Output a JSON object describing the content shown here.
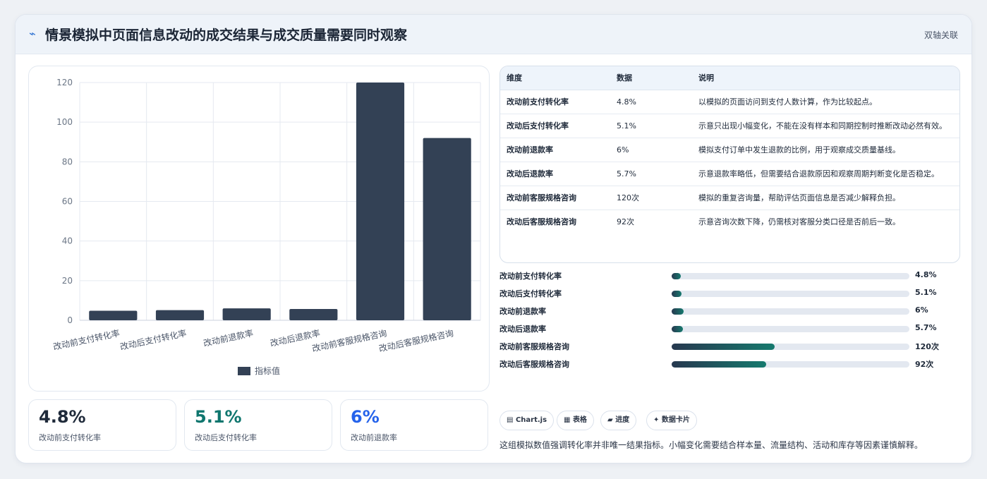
{
  "header": {
    "icon": "pulse-icon",
    "title": "情景模拟中页面信息改动的成交结果与成交质量需要同时观察",
    "mode": "双轴关联"
  },
  "chart_data": {
    "type": "bar",
    "categories": [
      "改动前支付转化率",
      "改动后支付转化率",
      "改动前退款率",
      "改动后退款率",
      "改动前客服规格咨询",
      "改动后客服规格咨询"
    ],
    "series": [
      {
        "name": "指标值",
        "values": [
          4.8,
          5.1,
          6,
          5.7,
          120,
          92
        ]
      }
    ],
    "ylim": [
      0,
      120
    ],
    "yticks": [
      0,
      20,
      40,
      60,
      80,
      100,
      120
    ],
    "grid": true,
    "legend": "bottom",
    "color": "#334155"
  },
  "stats": [
    {
      "value": "4.8%",
      "label": "改动前支付转化率",
      "color": "#1f2a3a"
    },
    {
      "value": "5.1%",
      "label": "改动后支付转化率",
      "color": "#0f766e"
    },
    {
      "value": "6%",
      "label": "改动前退款率",
      "color": "#2563eb"
    }
  ],
  "table": {
    "headers": [
      "维度",
      "数据",
      "说明"
    ],
    "rows": [
      [
        "改动前支付转化率",
        "4.8%",
        "以模拟的页面访问到支付人数计算，作为比较起点。"
      ],
      [
        "改动后支付转化率",
        "5.1%",
        "示意只出现小幅变化，不能在没有样本和同期控制时推断改动必然有效。"
      ],
      [
        "改动前退款率",
        "6%",
        "模拟支付订单中发生退款的比例，用于观察成交质量基线。"
      ],
      [
        "改动后退款率",
        "5.7%",
        "示意退款率略低，但需要结合退款原因和观察周期判断变化是否稳定。"
      ],
      [
        "改动前客服规格咨询",
        "120次",
        "模拟的重复咨询量，帮助评估页面信息是否减少解释负担。"
      ],
      [
        "改动后客服规格咨询",
        "92次",
        "示意咨询次数下降，仍需核对客服分类口径是否前后一致。"
      ]
    ]
  },
  "progress": [
    {
      "label": "改动前支付转化率",
      "value": "4.8%",
      "fraction": 0.04
    },
    {
      "label": "改动后支付转化率",
      "value": "5.1%",
      "fraction": 0.0425
    },
    {
      "label": "改动前退款率",
      "value": "6%",
      "fraction": 0.05
    },
    {
      "label": "改动后退款率",
      "value": "5.7%",
      "fraction": 0.0475
    },
    {
      "label": "改动前客服规格咨询",
      "value": "120次",
      "fraction": 0.4333
    },
    {
      "label": "改动后客服规格咨询",
      "value": "92次",
      "fraction": 0.3966
    }
  ],
  "tags": [
    {
      "icon": "chart-icon",
      "glyph": "▤",
      "label": "Chart.js"
    },
    {
      "icon": "table-icon",
      "glyph": "▦",
      "label": "表格"
    },
    {
      "icon": "progress-icon",
      "glyph": "▰",
      "label": "进度"
    },
    {
      "icon": "sparkle-icon",
      "glyph": "✦",
      "label": "数据卡片"
    }
  ],
  "note": "这组模拟数值强调转化率并非唯一结果指标。小幅变化需要结合样本量、流量结构、活动和库存等因素谨慎解释。"
}
